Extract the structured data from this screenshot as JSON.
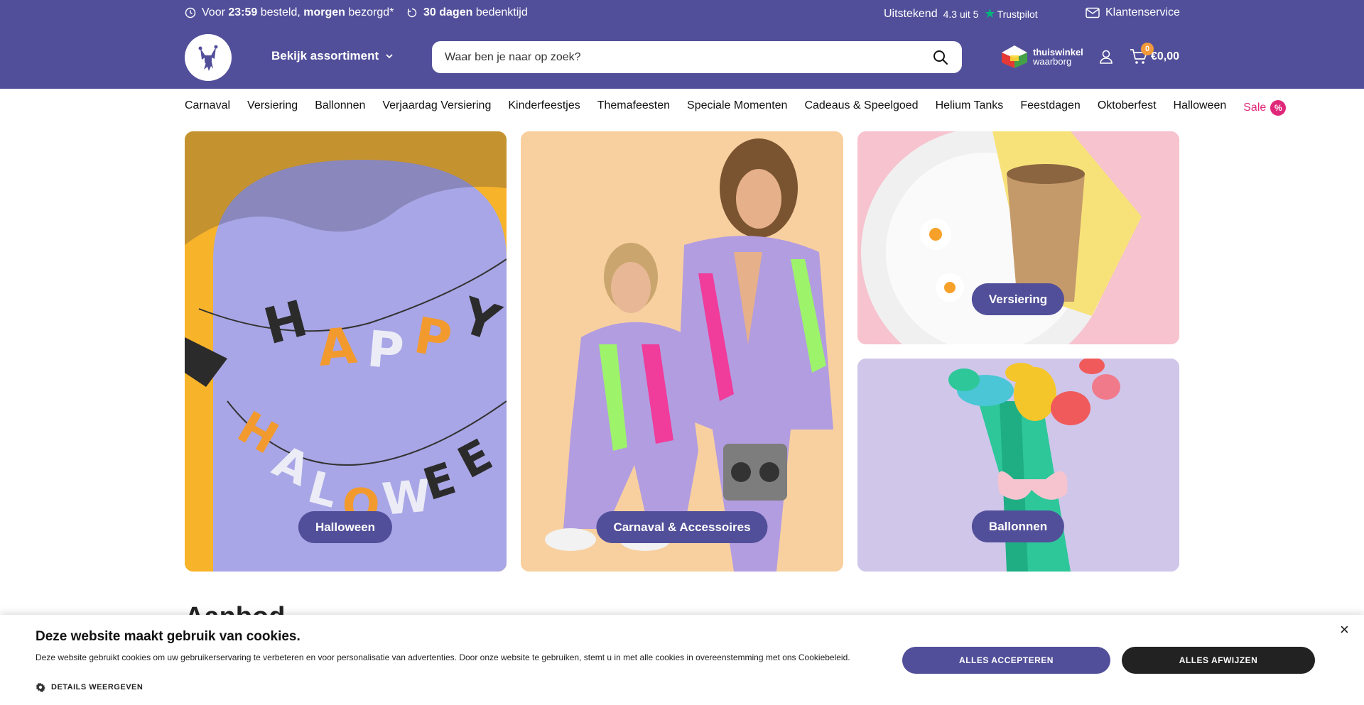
{
  "topbar": {
    "delivery_pre": "Voor",
    "delivery_time": "23:59",
    "delivery_mid": "besteld,",
    "delivery_day": "morgen",
    "delivery_post": "bezorgd*",
    "return_days": "30 dagen",
    "return_text": "bedenktijd",
    "rating_word": "Uitstekend",
    "rating_score": "4.3 uit 5",
    "trustpilot": "Trustpilot",
    "service": "Klantenservice"
  },
  "header": {
    "assortment_label": "Bekijk assortiment",
    "search_placeholder": "Waar ben je naar op zoek?",
    "thuiswinkel_line1": "thuiswinkel",
    "thuiswinkel_line2": "waarborg",
    "cart_count": "0",
    "cart_total": "€0,00"
  },
  "nav": {
    "items": [
      "Carnaval",
      "Versiering",
      "Ballonnen",
      "Verjaardag Versiering",
      "Kinderfeestjes",
      "Themafeesten",
      "Speciale Momenten",
      "Cadeaus & Speelgoed",
      "Helium Tanks",
      "Feestdagen",
      "Oktoberfest",
      "Halloween"
    ],
    "sale_label": "Sale",
    "sale_badge": "%"
  },
  "tiles": {
    "halloween": "Halloween",
    "carnaval": "Carnaval & Accessoires",
    "versiering": "Versiering",
    "ballonnen": "Ballonnen"
  },
  "section": {
    "title": "Aanbod"
  },
  "cookie": {
    "title": "Deze website maakt gebruik van cookies.",
    "text": "Deze website gebruikt cookies om uw gebruikerservaring te verbeteren en voor personalisatie van advertenties. Door onze website te gebruiken, stemt u in met alle cookies in overeenstemming met ons Cookiebeleid.",
    "details": "DETAILS WEERGEVEN",
    "accept": "ALLES ACCEPTEREN",
    "reject": "ALLES AFWIJZEN",
    "close": "×"
  },
  "colors": {
    "brand": "#524f9a",
    "sale": "#e0287a",
    "trustpilot": "#00b67a"
  }
}
